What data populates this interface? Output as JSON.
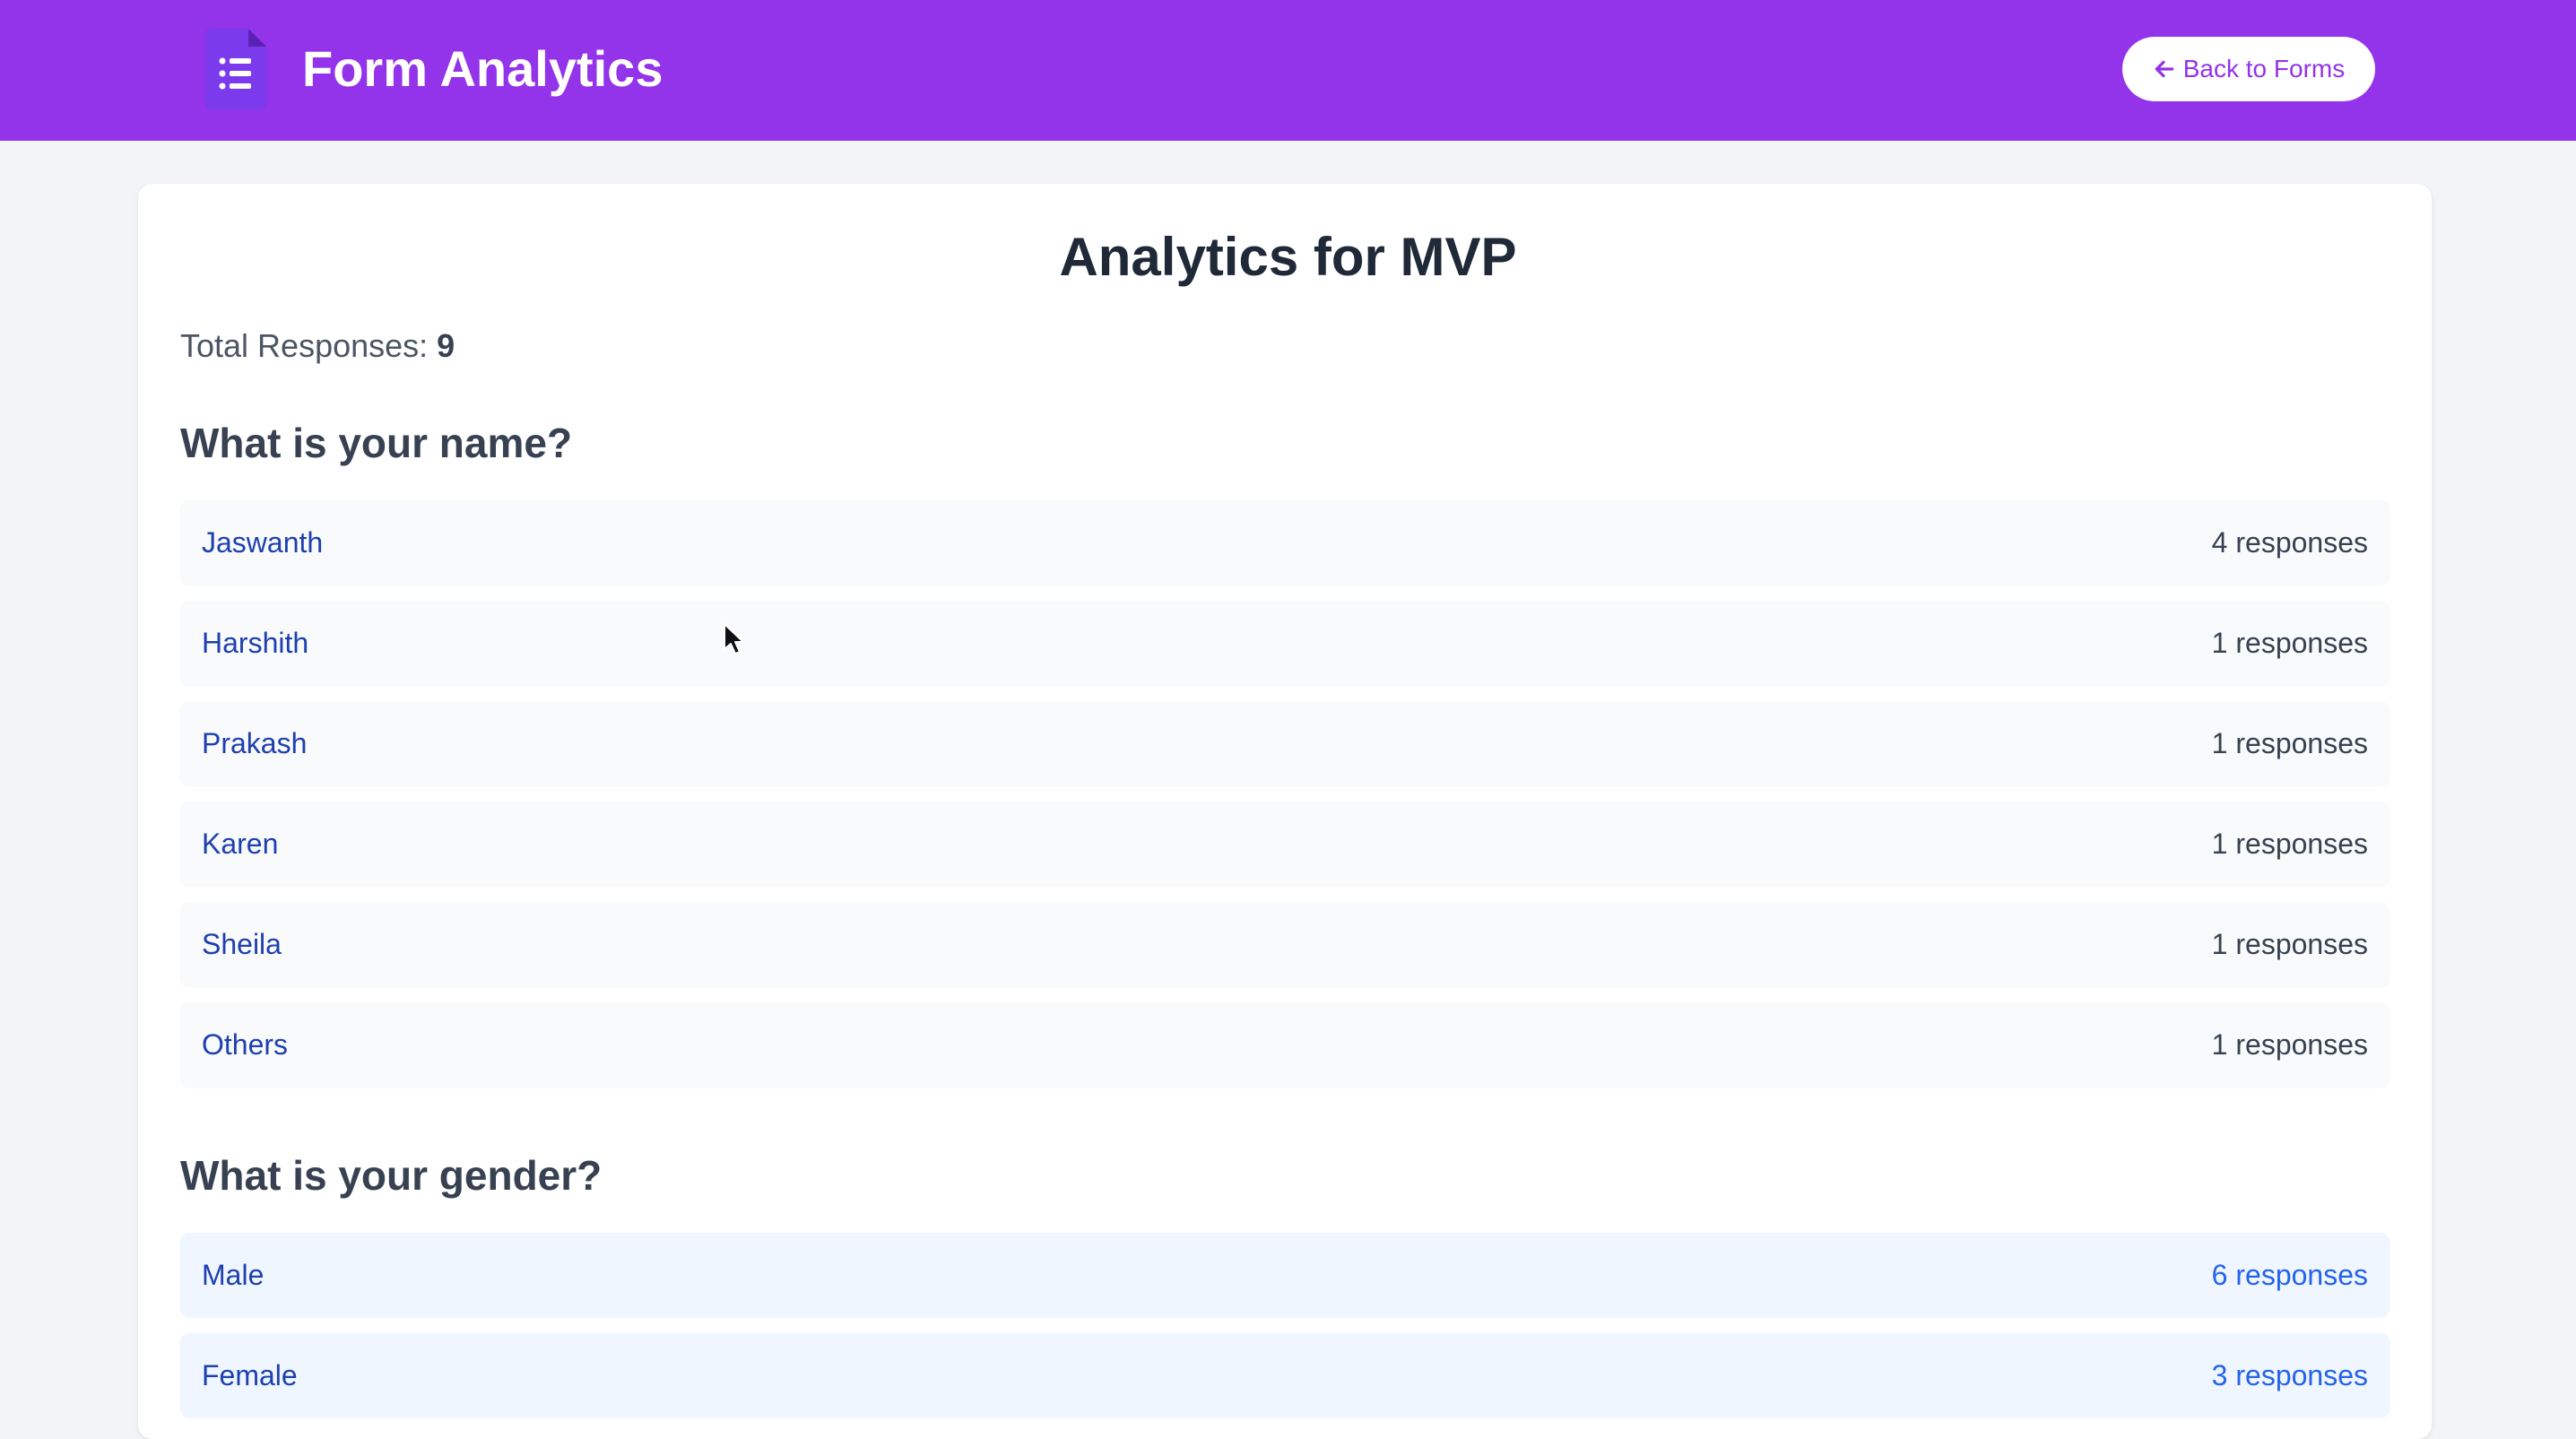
{
  "header": {
    "app_title": "Form Analytics",
    "back_label": "Back to Forms",
    "brand_icon": "form-document-icon",
    "accent_color": "#9333ea"
  },
  "main": {
    "title": "Analytics for MVP",
    "total_label": "Total Responses:",
    "total_value": "9",
    "questions": [
      {
        "title": "What is your name?",
        "answers": [
          {
            "label": "Jaswanth",
            "count": "4 responses"
          },
          {
            "label": "Harshith",
            "count": "1 responses"
          },
          {
            "label": "Prakash",
            "count": "1 responses"
          },
          {
            "label": "Karen",
            "count": "1 responses"
          },
          {
            "label": "Sheila",
            "count": "1 responses"
          },
          {
            "label": "Others",
            "count": "1 responses"
          }
        ]
      },
      {
        "title": "What is your gender?",
        "answers": [
          {
            "label": "Male",
            "count": "6 responses"
          },
          {
            "label": "Female",
            "count": "3 responses"
          }
        ]
      }
    ]
  }
}
